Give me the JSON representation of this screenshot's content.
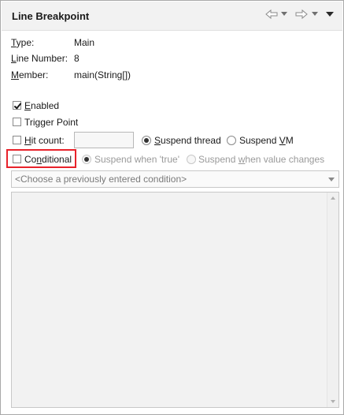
{
  "panel": {
    "title": "Line Breakpoint"
  },
  "toolbar": {
    "icons": [
      "back-arrow-icon",
      "dropdown-icon",
      "forward-arrow-icon",
      "dropdown-icon",
      "view-menu-icon"
    ]
  },
  "info": {
    "type_label": "Type:",
    "type_value": "Main",
    "line_label": "Line Number:",
    "line_value": "8",
    "member_label": "Member:",
    "member_value": "main(String[])"
  },
  "options": {
    "enabled_label": "Enabled",
    "enabled_checked": true,
    "trigger_label": "Trigger Point",
    "trigger_checked": false,
    "hit_count_label": "Hit count:",
    "hit_count_checked": false,
    "hit_count_value": "",
    "suspend_thread_label": "Suspend thread",
    "suspend_thread_selected": true,
    "suspend_vm_label": "Suspend VM",
    "conditional_label": "Conditional",
    "conditional_checked": false,
    "suspend_true_label": "Suspend when 'true'",
    "suspend_changes_label": "Suspend when value changes"
  },
  "condition": {
    "combo_text": "<Choose a previously entered condition>"
  },
  "colors": {
    "highlight": "#e8222b",
    "title_bar": "#f2f2f2"
  }
}
